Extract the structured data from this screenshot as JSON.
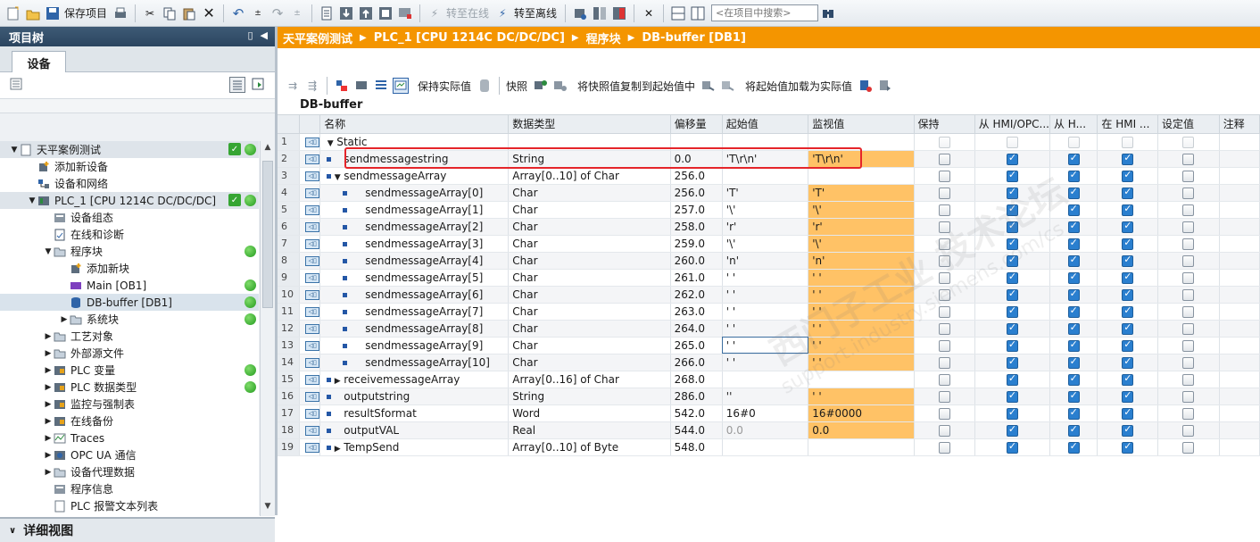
{
  "toolbar": {
    "save_project": "保存项目",
    "go_online": "转至在线",
    "go_offline": "转至离线",
    "search_placeholder": "<在项目中搜索>"
  },
  "project_tree": {
    "title": "项目树",
    "tab_devices": "设备",
    "items": [
      {
        "label": "天平案例测试",
        "check": true,
        "dot": true
      },
      {
        "label": "添加新设备"
      },
      {
        "label": "设备和网络"
      },
      {
        "label": "PLC_1 [CPU 1214C DC/DC/DC]",
        "check": true,
        "dot": true
      },
      {
        "label": "设备组态"
      },
      {
        "label": "在线和诊断"
      },
      {
        "label": "程序块",
        "dot": true
      },
      {
        "label": "添加新块"
      },
      {
        "label": "Main [OB1]",
        "dot": true
      },
      {
        "label": "DB-buffer [DB1]",
        "dot": true
      },
      {
        "label": "系统块",
        "dot": true
      },
      {
        "label": "工艺对象"
      },
      {
        "label": "外部源文件"
      },
      {
        "label": "PLC 变量",
        "dot": true
      },
      {
        "label": "PLC 数据类型",
        "dot": true
      },
      {
        "label": "监控与强制表"
      },
      {
        "label": "在线备份"
      },
      {
        "label": "Traces"
      },
      {
        "label": "OPC UA 通信"
      },
      {
        "label": "设备代理数据"
      },
      {
        "label": "程序信息"
      },
      {
        "label": "PLC 报警文本列表"
      }
    ],
    "detail_view": "详细视图"
  },
  "breadcrumb": [
    "天平案例测试",
    "PLC_1 [CPU 1214C DC/DC/DC]",
    "程序块",
    "DB-buffer [DB1]"
  ],
  "editor_toolbar": {
    "keep_actual": "保持实际值",
    "snapshot": "快照",
    "copy_snapshot": "将快照值复制到起始值中",
    "load_start": "将起始值加载为实际值"
  },
  "db_title": "DB-buffer",
  "table": {
    "headers": [
      "名称",
      "数据类型",
      "偏移量",
      "起始值",
      "监视值",
      "保持",
      "从 HMI/OPC...",
      "从 H...",
      "在 HMI ...",
      "设定值",
      "注释"
    ],
    "rows": [
      {
        "n": "1",
        "name": "Static",
        "type": "",
        "offset": "",
        "start": "",
        "mon": "",
        "indent": 0,
        "caret": "▼",
        "sq": false,
        "checks": false
      },
      {
        "n": "2",
        "name": "sendmessagestring",
        "type": "String",
        "offset": "0.0",
        "start": "'T\\r\\n'",
        "mon": "'T\\r\\n'",
        "indent": 1,
        "caret": "",
        "sq": true,
        "checks": true
      },
      {
        "n": "3",
        "name": "sendmessageArray",
        "type": "Array[0..10] of Char",
        "offset": "256.0",
        "start": "",
        "mon": "",
        "indent": 1,
        "caret": "▼",
        "sq": true,
        "checks": true
      },
      {
        "n": "4",
        "name": "sendmessageArray[0]",
        "type": "Char",
        "offset": "256.0",
        "start": "'T'",
        "mon": "'T'",
        "indent": 2,
        "caret": "",
        "sq": true,
        "checks": true
      },
      {
        "n": "5",
        "name": "sendmessageArray[1]",
        "type": "Char",
        "offset": "257.0",
        "start": "'\\'",
        "mon": "'\\'",
        "indent": 2,
        "caret": "",
        "sq": true,
        "checks": true
      },
      {
        "n": "6",
        "name": "sendmessageArray[2]",
        "type": "Char",
        "offset": "258.0",
        "start": "'r'",
        "mon": "'r'",
        "indent": 2,
        "caret": "",
        "sq": true,
        "checks": true
      },
      {
        "n": "7",
        "name": "sendmessageArray[3]",
        "type": "Char",
        "offset": "259.0",
        "start": "'\\'",
        "mon": "'\\'",
        "indent": 2,
        "caret": "",
        "sq": true,
        "checks": true
      },
      {
        "n": "8",
        "name": "sendmessageArray[4]",
        "type": "Char",
        "offset": "260.0",
        "start": "'n'",
        "mon": "'n'",
        "indent": 2,
        "caret": "",
        "sq": true,
        "checks": true
      },
      {
        "n": "9",
        "name": "sendmessageArray[5]",
        "type": "Char",
        "offset": "261.0",
        "start": "' '",
        "mon": "' '",
        "indent": 2,
        "caret": "",
        "sq": true,
        "checks": true
      },
      {
        "n": "10",
        "name": "sendmessageArray[6]",
        "type": "Char",
        "offset": "262.0",
        "start": "' '",
        "mon": "' '",
        "indent": 2,
        "caret": "",
        "sq": true,
        "checks": true
      },
      {
        "n": "11",
        "name": "sendmessageArray[7]",
        "type": "Char",
        "offset": "263.0",
        "start": "' '",
        "mon": "' '",
        "indent": 2,
        "caret": "",
        "sq": true,
        "checks": true
      },
      {
        "n": "12",
        "name": "sendmessageArray[8]",
        "type": "Char",
        "offset": "264.0",
        "start": "' '",
        "mon": "' '",
        "indent": 2,
        "caret": "",
        "sq": true,
        "checks": true
      },
      {
        "n": "13",
        "name": "sendmessageArray[9]",
        "type": "Char",
        "offset": "265.0",
        "start": "' '",
        "mon": "' '",
        "indent": 2,
        "caret": "",
        "sq": true,
        "checks": true,
        "focus": true
      },
      {
        "n": "14",
        "name": "sendmessageArray[10]",
        "type": "Char",
        "offset": "266.0",
        "start": "' '",
        "mon": "' '",
        "indent": 2,
        "caret": "",
        "sq": true,
        "checks": true
      },
      {
        "n": "15",
        "name": "receivemessageArray",
        "type": "Array[0..16] of Char",
        "offset": "268.0",
        "start": "",
        "mon": "",
        "indent": 1,
        "caret": "▶",
        "sq": true,
        "checks": true
      },
      {
        "n": "16",
        "name": "outputstring",
        "type": "String",
        "offset": "286.0",
        "start": "''",
        "mon": "'        '",
        "indent": 1,
        "caret": "",
        "sq": true,
        "checks": true
      },
      {
        "n": "17",
        "name": "resultSformat",
        "type": "Word",
        "offset": "542.0",
        "start": "16#0",
        "mon": "16#0000",
        "indent": 1,
        "caret": "",
        "sq": true,
        "checks": true
      },
      {
        "n": "18",
        "name": "outputVAL",
        "type": "Real",
        "offset": "544.0",
        "start": "0.0",
        "mon": "0.0",
        "indent": 1,
        "caret": "",
        "sq": true,
        "checks": true,
        "dimstart": true
      },
      {
        "n": "19",
        "name": "TempSend",
        "type": "Array[0..10] of Byte",
        "offset": "548.0",
        "start": "",
        "mon": "",
        "indent": 1,
        "caret": "▶",
        "sq": true,
        "checks": true
      }
    ]
  },
  "watermark": {
    "line1": "西门子工业 技术论坛",
    "line2": "support.industry.siemens.com/cs"
  },
  "colors": {
    "accent_orange": "#f49500",
    "monitor_cell": "#ffc266",
    "highlight_red": "#e5252a",
    "status_green": "#36a533"
  }
}
